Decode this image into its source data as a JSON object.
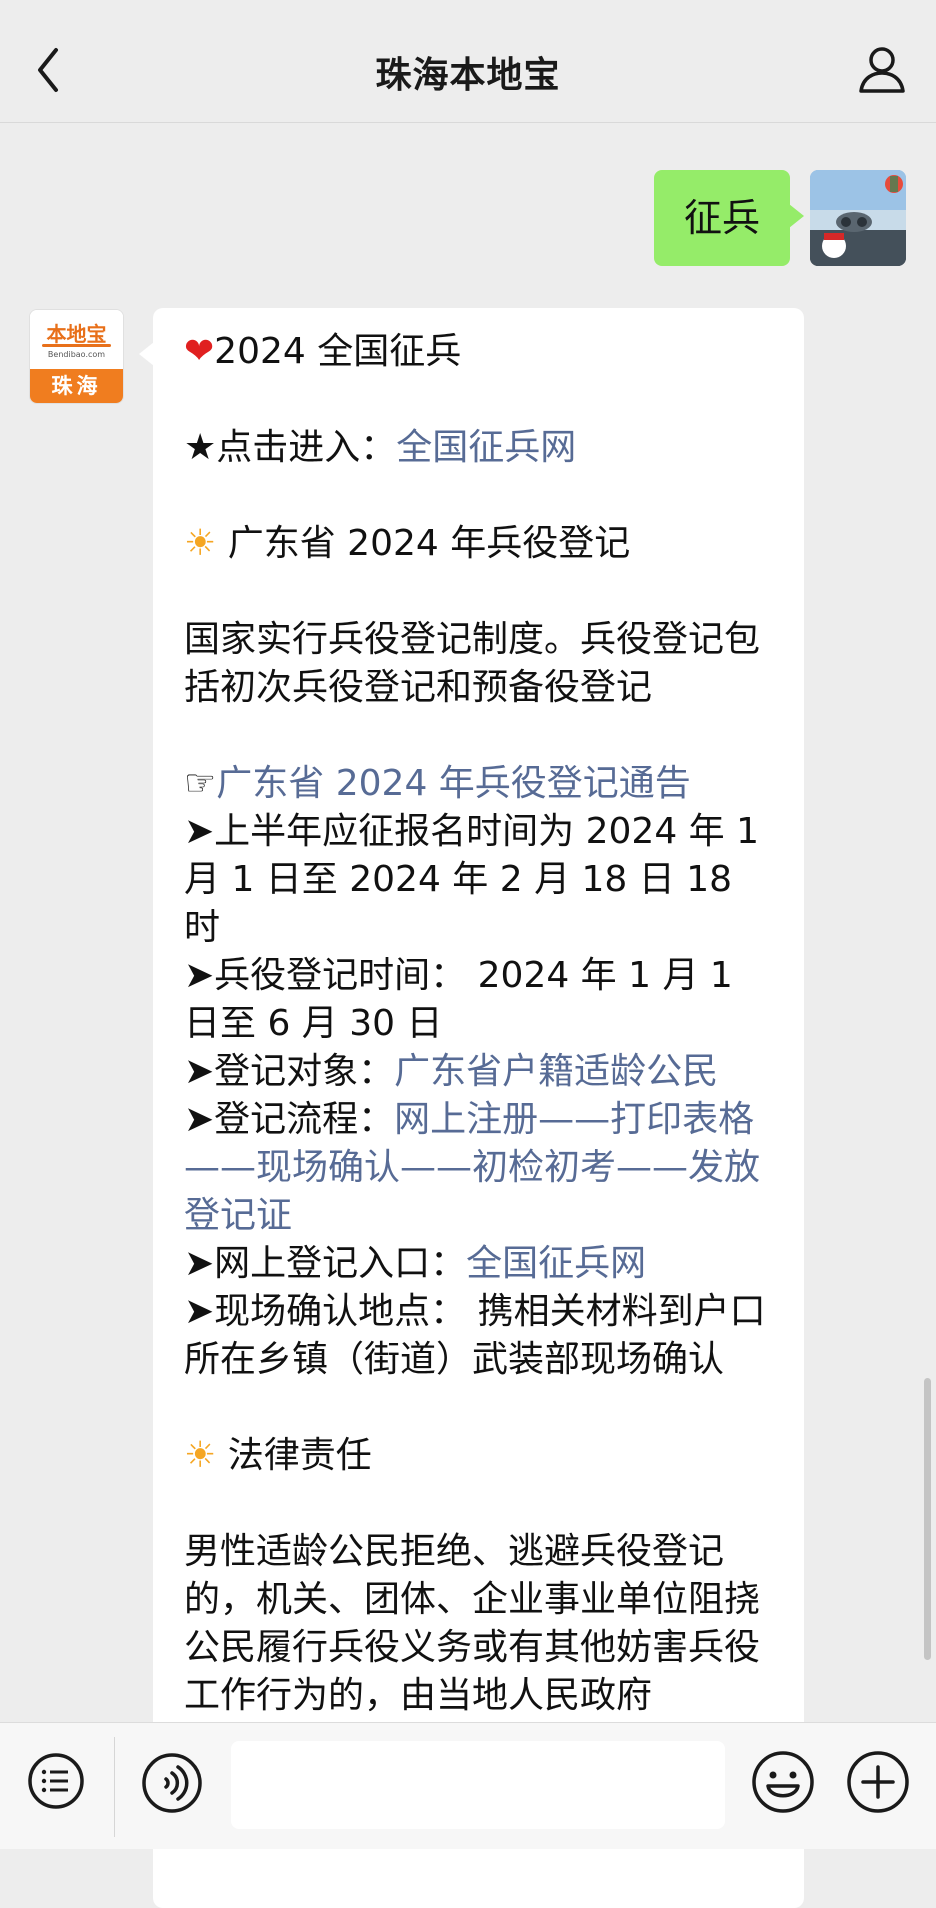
{
  "header": {
    "title": "珠海本地宝",
    "back_icon": "chevron-left-icon",
    "profile_icon": "person-icon"
  },
  "user_message": {
    "text": "征兵"
  },
  "bot_avatar": {
    "brand": "本地宝",
    "domain": "Bendibao.com",
    "city": "珠海"
  },
  "bot_message": {
    "l1_emoji": "❤",
    "l1_text": "2024 全国征兵",
    "l2_text": "★点击进入：",
    "l2_link": "全国征兵网",
    "l3_emoji": "☀",
    "l3_text": " 广东省 2024 年兵役登记",
    "l4_text": "国家实行兵役登记制度。兵役登记包括初次兵役登记和预备役登记",
    "l5_prefix": "☞",
    "l5_link": "广东省 2024 年兵役登记通告",
    "l6_text": "➤上半年应征报名时间为 2024 年 1 月 1 日至 2024 年 2 月 18 日 18 时",
    "l7_text": "➤兵役登记时间：  2024 年 1 月 1 日至 6 月 30 日",
    "l8_label": "➤登记对象：",
    "l8_link": "广东省户籍适龄公民",
    "l9_label": "➤登记流程：",
    "l9_link": "网上注册——打印表格——现场确认——初检初考——发放登记证",
    "l10_label": "➤网上登记入口：",
    "l10_link": "全国征兵网",
    "l11_text": "➤现场确认地点：  携相关材料到户口所在乡镇（街道）武装部现场确认",
    "l12_emoji": "☀",
    "l12_text": " 法律责任",
    "l13_text": "男性适龄公民拒绝、逃避兵役登记的，机关、团体、企业事业单位阻挠公民履行兵役义务或有其他妨害兵役工作行为的，由当地人民政府"
  },
  "footer": {
    "menu_icon": "list-menu-icon",
    "voice_icon": "voice-icon",
    "input_placeholder": "",
    "emoji_icon": "smiley-icon",
    "plus_icon": "plus-icon"
  },
  "colors": {
    "link": "#576b95",
    "user_bubble": "#95ec69",
    "background": "#ededed",
    "brand_orange": "#f07d1f"
  }
}
